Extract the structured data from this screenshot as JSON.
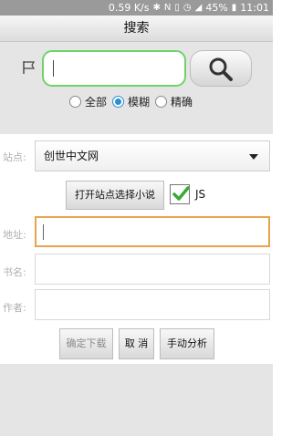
{
  "status_bar": {
    "speed": "0.59 K/s",
    "battery": "45%",
    "time": "11:01",
    "icons": [
      "bluetooth-icon",
      "nfc-icon",
      "vibrate-icon",
      "alarm-icon",
      "signal-icon",
      "battery-icon"
    ]
  },
  "title": "搜索",
  "search": {
    "value": "",
    "button_icon": "magnifier-icon",
    "flag_icon": "flag-icon"
  },
  "modes": {
    "options": [
      "全部",
      "模糊",
      "精确"
    ],
    "selected": "模糊"
  },
  "site": {
    "label": "站点:",
    "value": "创世中文网"
  },
  "open_site_button": "打开站点选择小说",
  "js": {
    "label": "JS",
    "checked": true
  },
  "address": {
    "label": "地址:",
    "value": ""
  },
  "book_name": {
    "label": "书名:",
    "value": ""
  },
  "author": {
    "label": "作者:",
    "value": ""
  },
  "actions": {
    "confirm": "确定下载",
    "cancel": "取 消",
    "analyze": "手动分析"
  },
  "colors": {
    "accent_green": "#6fd36a",
    "focus_orange": "#e8a34b",
    "radio_blue": "#2a8fcf",
    "check_green": "#3aa935"
  }
}
